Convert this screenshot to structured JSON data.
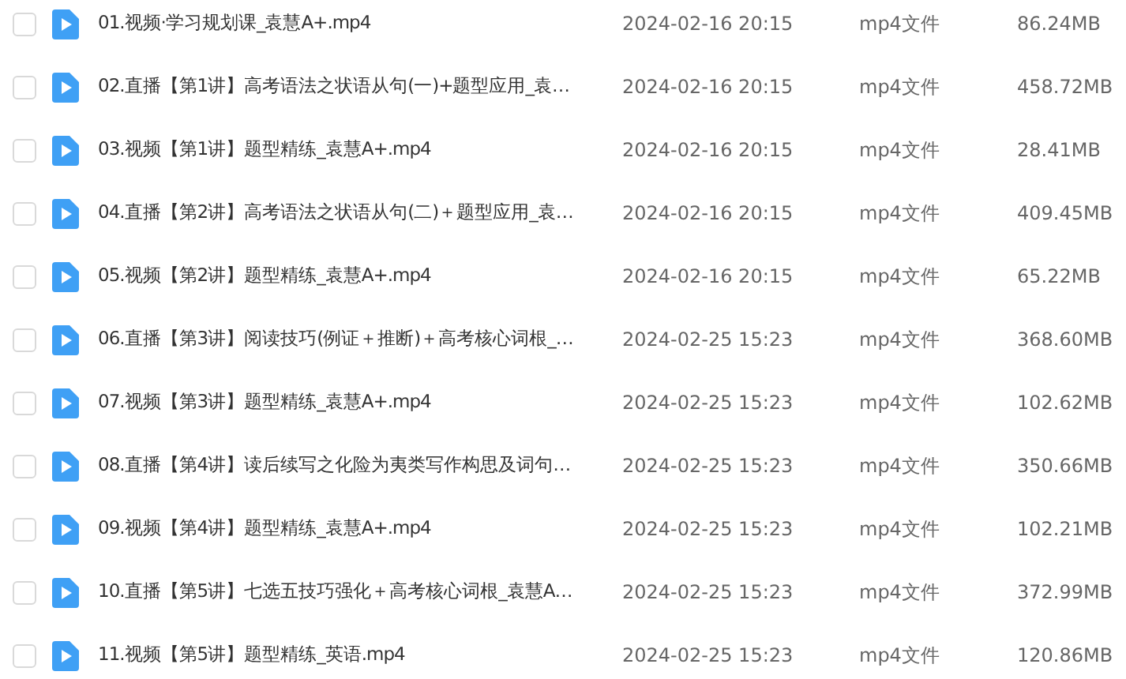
{
  "files": [
    {
      "name": "01.视频·学习规划课_袁慧A+.mp4",
      "modified": "2024-02-16 20:15",
      "type": "mp4文件",
      "size": "86.24MB",
      "checked": false
    },
    {
      "name": "02.直播【第1讲】高考语法之状语从句(一)+题型应用_袁…",
      "modified": "2024-02-16 20:15",
      "type": "mp4文件",
      "size": "458.72MB",
      "checked": false
    },
    {
      "name": "03.视频【第1讲】题型精练_袁慧A+.mp4",
      "modified": "2024-02-16 20:15",
      "type": "mp4文件",
      "size": "28.41MB",
      "checked": false
    },
    {
      "name": "04.直播【第2讲】高考语法之状语从句(二)＋题型应用_袁…",
      "modified": "2024-02-16 20:15",
      "type": "mp4文件",
      "size": "409.45MB",
      "checked": false
    },
    {
      "name": "05.视频【第2讲】题型精练_袁慧A+.mp4",
      "modified": "2024-02-16 20:15",
      "type": "mp4文件",
      "size": "65.22MB",
      "checked": false
    },
    {
      "name": "06.直播【第3讲】阅读技巧(例证＋推断)＋高考核心词根_…",
      "modified": "2024-02-25 15:23",
      "type": "mp4文件",
      "size": "368.60MB",
      "checked": false
    },
    {
      "name": "07.视频【第3讲】题型精练_袁慧A+.mp4",
      "modified": "2024-02-25 15:23",
      "type": "mp4文件",
      "size": "102.62MB",
      "checked": false
    },
    {
      "name": "08.直播【第4讲】读后续写之化险为夷类写作构思及词句…",
      "modified": "2024-02-25 15:23",
      "type": "mp4文件",
      "size": "350.66MB",
      "checked": false
    },
    {
      "name": "09.视频【第4讲】题型精练_袁慧A+.mp4",
      "modified": "2024-02-25 15:23",
      "type": "mp4文件",
      "size": "102.21MB",
      "checked": false
    },
    {
      "name": "10.直播【第5讲】七选五技巧强化＋高考核心词根_袁慧A…",
      "modified": "2024-02-25 15:23",
      "type": "mp4文件",
      "size": "372.99MB",
      "checked": false
    },
    {
      "name": "11.视频【第5讲】题型精练_英语.mp4",
      "modified": "2024-02-25 15:23",
      "type": "mp4文件",
      "size": "120.86MB",
      "checked": false
    }
  ]
}
